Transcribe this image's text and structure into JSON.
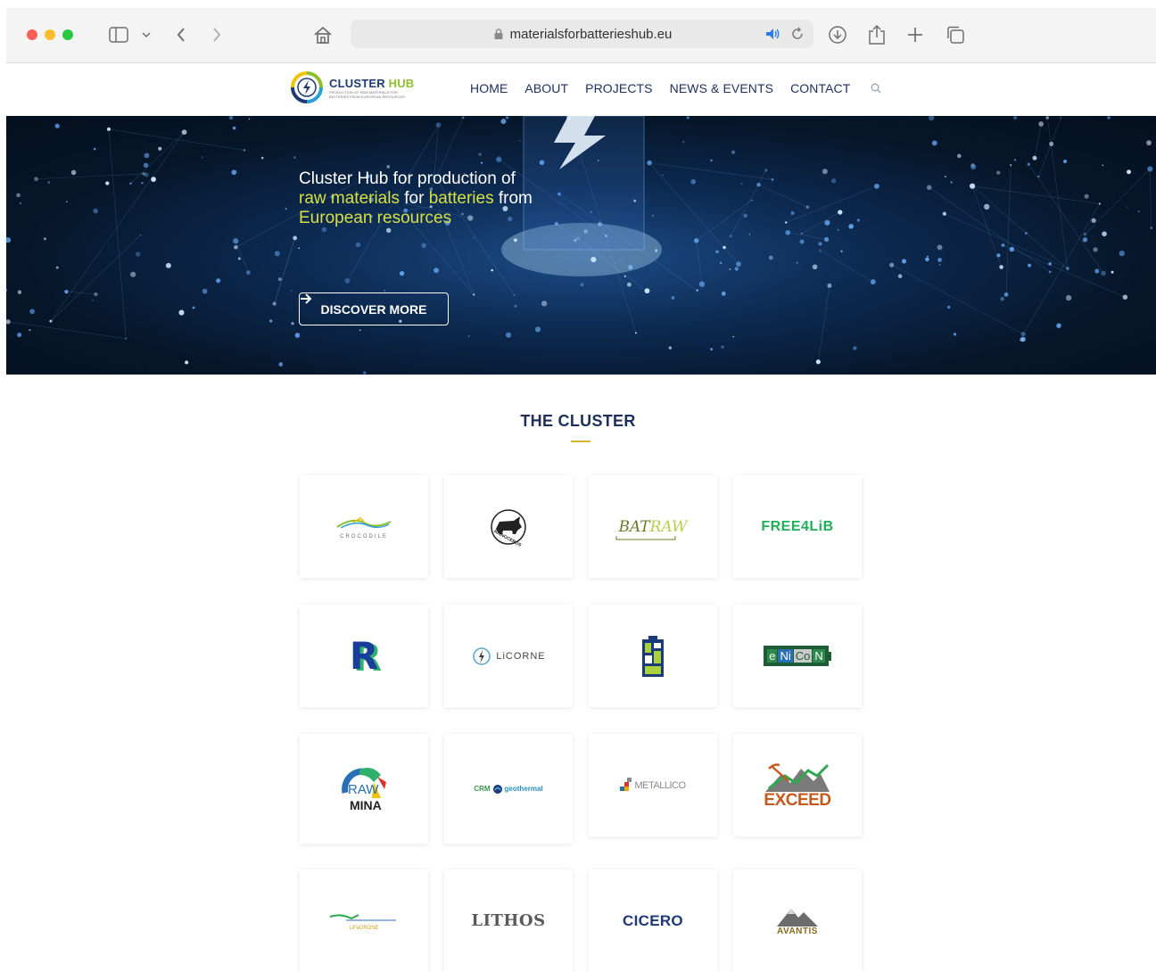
{
  "browser": {
    "url": "materialsforbatterieshub.eu"
  },
  "header": {
    "logo_title_main": "CLUSTER ",
    "logo_title_accent": "HUB",
    "logo_subtitle": "PRODUCTION OF RAW MATERIALS FOR BATTERIES FROM EUROPEAN RESOURCES",
    "nav": [
      "HOME",
      "ABOUT",
      "PROJECTS",
      "NEWS & EVENTS",
      "CONTACT"
    ]
  },
  "hero": {
    "title_part1": "Cluster Hub for production of ",
    "title_accent1": "raw materials",
    "title_part2": " for ",
    "title_accent2": "batteries",
    "title_part3": " from ",
    "title_accent3": "European resources",
    "button_label": "DISCOVER MORE",
    "colors": {
      "accent": "#d6e044"
    }
  },
  "section": {
    "title": "THE CLUSTER"
  },
  "projects": [
    {
      "name": "CROCODILE",
      "logo_text": "CROCODILE"
    },
    {
      "name": "RHINOCEROS",
      "logo_text": "RHINOCEROS"
    },
    {
      "name": "BATRAW",
      "logo_text_a": "BAT",
      "logo_text_b": "RAW"
    },
    {
      "name": "FREE4LIB",
      "logo_text": "FREE4LiB"
    },
    {
      "name": "R",
      "logo_text": "R"
    },
    {
      "name": "LICORNE",
      "logo_text": "LiCORNE"
    },
    {
      "name": "battery-icon-project",
      "logo_text": ""
    },
    {
      "name": "ENICON",
      "logo_text_parts": [
        "e",
        "Ni",
        "Co",
        "N"
      ]
    },
    {
      "name": "RAWMINA",
      "logo_text_a": "RAW",
      "logo_text_b": "MINA"
    },
    {
      "name": "CRM-GEOTHERMAL",
      "logo_text_a": "CRM",
      "logo_text_b": "geothermal"
    },
    {
      "name": "METALLICO",
      "logo_text": "METALLICO"
    },
    {
      "name": "EXCEED",
      "logo_text": "EXCEED"
    },
    {
      "name": "LIFEDRONE",
      "logo_text": "LiFeDRONE"
    },
    {
      "name": "LITHOS",
      "logo_text": "LITHOS"
    },
    {
      "name": "CICERO",
      "logo_text": "CICERO"
    },
    {
      "name": "AVANTIS",
      "logo_text": "AVANTIS"
    }
  ]
}
